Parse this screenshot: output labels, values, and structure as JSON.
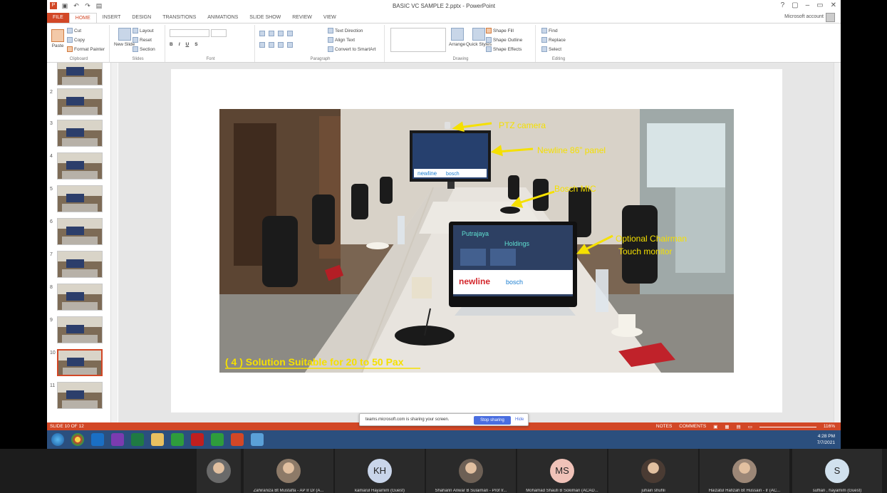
{
  "window": {
    "title": "BASIC VC SAMPLE 2.pptx - PowerPoint",
    "controls": [
      "?",
      "▢",
      "–",
      "▭",
      "✕"
    ],
    "account": "Microsoft account"
  },
  "tabs": [
    "FILE",
    "HOME",
    "INSERT",
    "DESIGN",
    "TRANSITIONS",
    "ANIMATIONS",
    "SLIDE SHOW",
    "REVIEW",
    "VIEW"
  ],
  "ribbon": {
    "clipboard": {
      "paste": "Paste",
      "cut": "Cut",
      "copy": "Copy",
      "format_painter": "Format Painter",
      "label": "Clipboard"
    },
    "slides": {
      "new_slide": "New Slide",
      "layout": "Layout",
      "reset": "Reset",
      "section": "Section",
      "label": "Slides"
    },
    "font": {
      "label": "Font",
      "bold": "B",
      "italic": "I",
      "underline": "U",
      "strike": "S"
    },
    "paragraph": {
      "text_direction": "Text Direction",
      "align_text": "Align Text",
      "smartart": "Convert to SmartArt",
      "label": "Paragraph"
    },
    "drawing": {
      "arrange": "Arrange",
      "quick_styles": "Quick Styles",
      "shape_fill": "Shape Fill",
      "shape_outline": "Shape Outline",
      "shape_effects": "Shape Effects",
      "label": "Drawing"
    },
    "editing": {
      "find": "Find",
      "replace": "Replace",
      "select": "Select",
      "label": "Editing"
    }
  },
  "thumbnails": [
    {
      "num": ""
    },
    {
      "num": "2"
    },
    {
      "num": "3"
    },
    {
      "num": "4"
    },
    {
      "num": "5"
    },
    {
      "num": "6"
    },
    {
      "num": "7"
    },
    {
      "num": "8"
    },
    {
      "num": "9"
    },
    {
      "num": "10"
    },
    {
      "num": "11"
    }
  ],
  "slide": {
    "labels": {
      "ptz": "PTZ camera",
      "panel": "Newline 86” panel",
      "mic": "Bosch MIC",
      "chairman1": "Optional Chairman",
      "chairman2": "Touch monitor"
    },
    "caption": "( 4 ) Solution Suitable for 20 to 50 Pax",
    "screen_brand": "newline",
    "screen_brand2": "bosch",
    "monitor_text1": "Putrajaya",
    "monitor_text2": "Holdings"
  },
  "statusbar": {
    "slide": "SLIDE 10 OF 12",
    "notes": "NOTES",
    "comments": "COMMENTS",
    "zoom": "116%"
  },
  "share": {
    "message": "teams.microsoft.com is sharing your screen.",
    "stop": "Stop sharing",
    "hide": "Hide"
  },
  "tray": {
    "time": "4:28 PM",
    "date": "7/7/2021"
  },
  "participants": [
    {
      "name": "",
      "initials": "",
      "type": "photo"
    },
    {
      "name": "Zahiraniza Bt Mustaffa - AP Ir Dr (A...",
      "initials": "",
      "type": "photo"
    },
    {
      "name": "kamarul Hayamim (Guest)",
      "initials": "KH",
      "type": "initials"
    },
    {
      "name": "Shaharin Anwar B Sulaiman - Prof Ir...",
      "initials": "",
      "type": "photo"
    },
    {
      "name": "Mohamad Shaufi B Sokiman (ACAD...",
      "initials": "MS",
      "type": "initials"
    },
    {
      "name": "juhairi shuhli",
      "initials": "",
      "type": "photo"
    },
    {
      "name": "Haizatul Hafizah Bt Hussain - Ir (AC...",
      "initials": "",
      "type": "photo"
    },
    {
      "name": "suffian , hayamim (Guest)",
      "initials": "S",
      "type": "initials"
    }
  ],
  "colors": {
    "accent": "#d24726",
    "taskbar": "#2b4f7e",
    "label_yellow": "#f5e000"
  }
}
